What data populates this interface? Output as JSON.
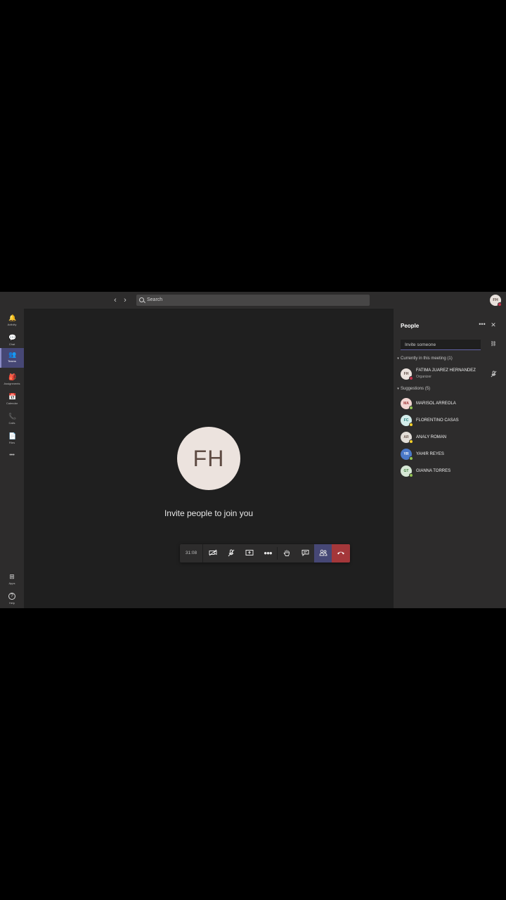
{
  "search": {
    "placeholder": "Search"
  },
  "me": {
    "initials": "FH"
  },
  "rail": [
    {
      "label": "Activity",
      "icon": "bell-icon",
      "glyph": "🔔"
    },
    {
      "label": "Chat",
      "icon": "chat-icon",
      "glyph": "💬"
    },
    {
      "label": "Teams",
      "icon": "teams-icon",
      "glyph": "👥"
    },
    {
      "label": "Assignments",
      "icon": "assignments-icon",
      "glyph": "🎒"
    },
    {
      "label": "Calendar",
      "icon": "calendar-icon",
      "glyph": "📅"
    },
    {
      "label": "Calls",
      "icon": "phone-icon",
      "glyph": "📞"
    },
    {
      "label": "Files",
      "icon": "file-icon",
      "glyph": "📄"
    },
    {
      "label": "",
      "icon": "more-icon",
      "glyph": "•••"
    },
    {
      "label": "Apps",
      "icon": "apps-icon",
      "glyph": "⊞"
    },
    {
      "label": "Help",
      "icon": "help-icon",
      "glyph": "?"
    }
  ],
  "stage": {
    "avatar_initials": "FH",
    "message": "Invite people to join you"
  },
  "controls": {
    "timer": "31:08"
  },
  "panel": {
    "title": "People",
    "invite_placeholder": "Invite someone",
    "current_header": "Currently in this meeting (1)",
    "suggestions_header": "Suggestions (5)",
    "current": [
      {
        "initials": "FH",
        "name": "FATIMA JUAREZ HERNANDEZ",
        "role": "Organizer",
        "avatar_bg": "#ece3de",
        "avatar_fg": "#5e4b43",
        "presence": "#c4314b"
      }
    ],
    "suggestions": [
      {
        "initials": "MA",
        "name": "MARISOL ARREOLA",
        "avatar_bg": "#f3d6d3",
        "avatar_fg": "#a4373a",
        "presence": "#92c353"
      },
      {
        "initials": "FC",
        "name": "FLORENTINO CASAS",
        "avatar_bg": "#d3ecea",
        "avatar_fg": "#227c7c",
        "presence": "#f8d22a"
      },
      {
        "initials": "AR",
        "name": "ANALY ROMAN",
        "avatar_bg": "#e3ded8",
        "avatar_fg": "#6c5a4f",
        "presence": "#f8d22a"
      },
      {
        "initials": "YR",
        "name": "YAHIR REYES",
        "avatar_bg": "#4a78c8",
        "avatar_fg": "#ffffff",
        "presence": "#92c353"
      },
      {
        "initials": "GT",
        "name": "GIANNA TORRES",
        "avatar_bg": "#d7e8d6",
        "avatar_fg": "#3c7b3a",
        "presence": "#92c353"
      }
    ]
  },
  "colors": {
    "accent": "#6264a7",
    "hangup": "#a4373a",
    "busy": "#c4314b"
  }
}
